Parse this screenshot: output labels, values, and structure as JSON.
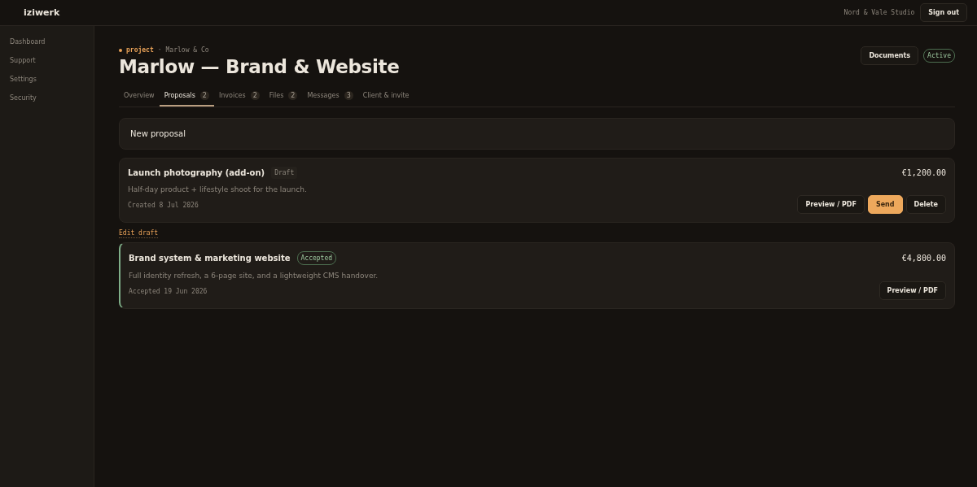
{
  "brand": "iziwerk",
  "account": {
    "studio": "Nord & Vale Studio",
    "sign_out": "Sign out"
  },
  "sidebar": {
    "items": [
      {
        "label": "Dashboard",
        "selected": false
      },
      {
        "label": "Support",
        "selected": false
      },
      {
        "label": "Settings",
        "selected": false
      },
      {
        "label": "Security",
        "selected": false
      }
    ]
  },
  "header": {
    "kind_label": "project",
    "separator": "·",
    "client": "Marlow & Co",
    "title": "Marlow — Brand & Website",
    "documents_button": "Documents",
    "status": "Active"
  },
  "tabs": [
    {
      "label": "Overview",
      "selected": false
    },
    {
      "label": "Proposals",
      "count": "2",
      "selected": true
    },
    {
      "label": "Invoices",
      "count": "2",
      "selected": false
    },
    {
      "label": "Files",
      "count": "2",
      "selected": false
    },
    {
      "label": "Messages",
      "count": "3",
      "selected": false
    },
    {
      "label": "Client & invite",
      "selected": false
    }
  ],
  "new_proposal": "New proposal",
  "proposals": [
    {
      "title": "Launch photography (add-on)",
      "status": "Draft",
      "kind": "draft",
      "amount": "€1,200.00",
      "description": "Half-day product + lifestyle shoot for the launch.",
      "date": "Created 8 Jul 2026",
      "buttons": [
        {
          "label": "Preview / PDF",
          "kind": "plain"
        },
        {
          "label": "Send",
          "kind": "primary"
        },
        {
          "label": "Delete",
          "kind": "plain"
        }
      ],
      "link": "Edit draft"
    },
    {
      "title": "Brand system & marketing website",
      "status": "Accepted",
      "kind": "accepted",
      "amount": "€4,800.00",
      "description": "Full identity refresh, a 6-page site, and a lightweight CMS handover.",
      "date": "Accepted 19 Jun 2026",
      "buttons": [
        {
          "label": "Preview / PDF",
          "kind": "plain"
        }
      ]
    }
  ]
}
